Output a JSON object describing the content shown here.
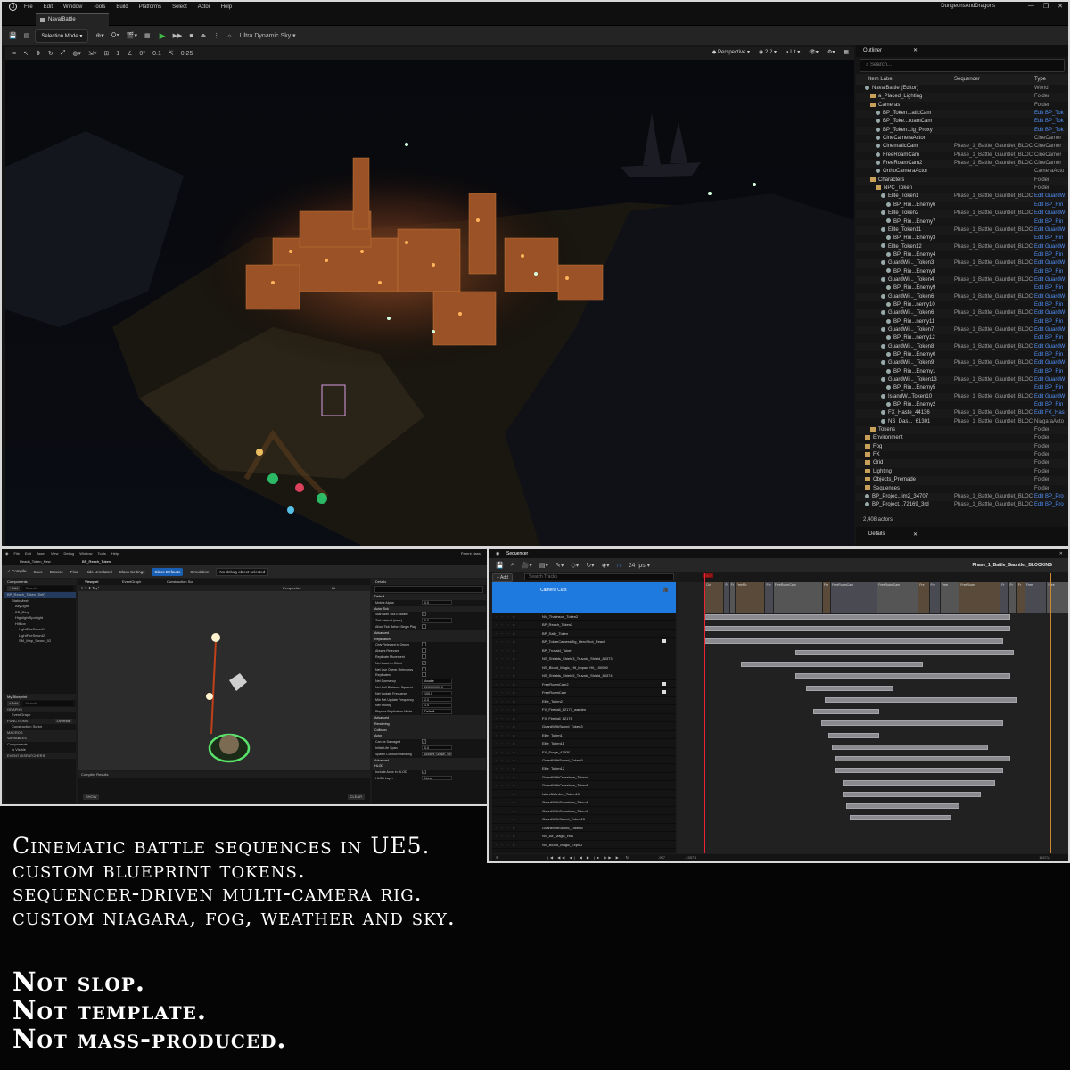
{
  "editor": {
    "menu": [
      "File",
      "Edit",
      "Window",
      "Tools",
      "Build",
      "Platforms",
      "Select",
      "Actor",
      "Help"
    ],
    "project_name": "DungeonsAndDragons",
    "level_tab": "NavalBattle",
    "toolbar": {
      "mode": "Selection Mode",
      "sky": "Ultra Dynamic Sky"
    },
    "viewport_toolbar": {
      "angle": "0°",
      "grid": "0.1",
      "scale": "0.25",
      "view": "Perspective",
      "fov": "2.2",
      "lit": "Lit",
      "snap": "1"
    }
  },
  "outliner": {
    "title": "Outliner",
    "search_placeholder": "Search...",
    "columns": {
      "label": "Item Label",
      "sequencer": "Sequencer",
      "type": "Type"
    },
    "rows": [
      {
        "indent": 1,
        "kind": "world",
        "label": "NavalBattle (Editor)",
        "seq": "",
        "type": "World",
        "link": false
      },
      {
        "indent": 2,
        "kind": "folder",
        "label": "a_Placed_Lighting",
        "seq": "",
        "type": "Folder",
        "link": false
      },
      {
        "indent": 2,
        "kind": "folder",
        "label": "Cameras",
        "seq": "",
        "type": "Folder",
        "link": false
      },
      {
        "indent": 3,
        "kind": "actor",
        "label": "BP_Token...aticCam",
        "seq": "",
        "type": "Edit BP_Tok",
        "link": true
      },
      {
        "indent": 3,
        "kind": "actor",
        "label": "BP_Toke...roamCam",
        "seq": "",
        "type": "Edit BP_Tok",
        "link": true
      },
      {
        "indent": 3,
        "kind": "actor",
        "label": "BP_Token...ig_Proxy",
        "seq": "",
        "type": "Edit BP_Tok",
        "link": true
      },
      {
        "indent": 3,
        "kind": "actor",
        "label": "CineCameraActor",
        "seq": "",
        "type": "CineCamer",
        "link": false
      },
      {
        "indent": 3,
        "kind": "actor",
        "label": "CinematicCam",
        "seq": "Phase_1_Battle_Gauntlet_BLOCK",
        "type": "CineCamer",
        "link": false
      },
      {
        "indent": 3,
        "kind": "actor",
        "label": "FreeRoamCam",
        "seq": "Phase_1_Battle_Gauntlet_BLOCK",
        "type": "CineCamer",
        "link": false
      },
      {
        "indent": 3,
        "kind": "actor",
        "label": "FreeRoamCam2",
        "seq": "Phase_1_Battle_Gauntlet_BLOCK",
        "type": "CineCamer",
        "link": false
      },
      {
        "indent": 3,
        "kind": "actor",
        "label": "OrthoCameraActor",
        "seq": "",
        "type": "CameraActo",
        "link": false
      },
      {
        "indent": 2,
        "kind": "folder",
        "label": "Characters",
        "seq": "",
        "type": "Folder",
        "link": false
      },
      {
        "indent": 3,
        "kind": "folder",
        "label": "NPC_Token",
        "seq": "",
        "type": "Folder",
        "link": false
      },
      {
        "indent": 4,
        "kind": "actor",
        "label": "Elite_Token1",
        "seq": "Phase_1_Battle_Gauntlet_BLOCK",
        "type": "Edit GuardW",
        "link": true
      },
      {
        "indent": 5,
        "kind": "actor",
        "label": "BP_Rin...Enemy6",
        "seq": "",
        "type": "Edit BP_Rin",
        "link": true
      },
      {
        "indent": 4,
        "kind": "actor",
        "label": "Elite_Token2",
        "seq": "Phase_1_Battle_Gauntlet_BLOCK",
        "type": "Edit GuardW",
        "link": true
      },
      {
        "indent": 5,
        "kind": "actor",
        "label": "BP_Rin...Enemy7",
        "seq": "",
        "type": "Edit BP_Rin",
        "link": true
      },
      {
        "indent": 4,
        "kind": "actor",
        "label": "Elite_Token11",
        "seq": "Phase_1_Battle_Gauntlet_BLOCK",
        "type": "Edit GuardW",
        "link": true
      },
      {
        "indent": 5,
        "kind": "actor",
        "label": "BP_Rin...Enemy3",
        "seq": "",
        "type": "Edit BP_Rin",
        "link": true
      },
      {
        "indent": 4,
        "kind": "actor",
        "label": "Elite_Token12",
        "seq": "Phase_1_Battle_Gauntlet_BLOCK",
        "type": "Edit GuardW",
        "link": true
      },
      {
        "indent": 5,
        "kind": "actor",
        "label": "BP_Rin...Enemy4",
        "seq": "",
        "type": "Edit BP_Rin",
        "link": true
      },
      {
        "indent": 4,
        "kind": "actor",
        "label": "GuardWi..._Token3",
        "seq": "Phase_1_Battle_Gauntlet_BLOCK",
        "type": "Edit GuardW",
        "link": true
      },
      {
        "indent": 5,
        "kind": "actor",
        "label": "BP_Rin...Enemy8",
        "seq": "",
        "type": "Edit BP_Rin",
        "link": true
      },
      {
        "indent": 4,
        "kind": "actor",
        "label": "GuardWi..._Token4",
        "seq": "Phase_1_Battle_Gauntlet_BLOCK",
        "type": "Edit GuardW",
        "link": true
      },
      {
        "indent": 5,
        "kind": "actor",
        "label": "BP_Rin...Enemy9",
        "seq": "",
        "type": "Edit BP_Rin",
        "link": true
      },
      {
        "indent": 4,
        "kind": "actor",
        "label": "GuardWi..._Token6",
        "seq": "Phase_1_Battle_Gauntlet_BLOCK",
        "type": "Edit GuardW",
        "link": true
      },
      {
        "indent": 5,
        "kind": "actor",
        "label": "BP_Rin...nemy10",
        "seq": "",
        "type": "Edit BP_Rin",
        "link": true
      },
      {
        "indent": 4,
        "kind": "actor",
        "label": "GuardWi..._Token6",
        "seq": "Phase_1_Battle_Gauntlet_BLOCK",
        "type": "Edit GuardW",
        "link": true
      },
      {
        "indent": 5,
        "kind": "actor",
        "label": "BP_Rin...nemy11",
        "seq": "",
        "type": "Edit BP_Rin",
        "link": true
      },
      {
        "indent": 4,
        "kind": "actor",
        "label": "GuardWi..._Token7",
        "seq": "Phase_1_Battle_Gauntlet_BLOCK",
        "type": "Edit GuardW",
        "link": true
      },
      {
        "indent": 5,
        "kind": "actor",
        "label": "BP_Rin...nemy12",
        "seq": "",
        "type": "Edit BP_Rin",
        "link": true
      },
      {
        "indent": 4,
        "kind": "actor",
        "label": "GuardWi..._Token8",
        "seq": "Phase_1_Battle_Gauntlet_BLOCK",
        "type": "Edit GuardW",
        "link": true
      },
      {
        "indent": 5,
        "kind": "actor",
        "label": "BP_Rin...Enemy0",
        "seq": "",
        "type": "Edit BP_Rin",
        "link": true
      },
      {
        "indent": 4,
        "kind": "actor",
        "label": "GuardWi..._Token9",
        "seq": "Phase_1_Battle_Gauntlet_BLOCK",
        "type": "Edit GuardW",
        "link": true
      },
      {
        "indent": 5,
        "kind": "actor",
        "label": "BP_Rin...Enemy1",
        "seq": "",
        "type": "Edit BP_Rin",
        "link": true
      },
      {
        "indent": 4,
        "kind": "actor",
        "label": "GuardWi..._Token13",
        "seq": "Phase_1_Battle_Gauntlet_BLOCK",
        "type": "Edit GuardW",
        "link": true
      },
      {
        "indent": 5,
        "kind": "actor",
        "label": "BP_Rin...Enemy5",
        "seq": "",
        "type": "Edit BP_Rin",
        "link": true
      },
      {
        "indent": 4,
        "kind": "actor",
        "label": "IslandW...Token10",
        "seq": "Phase_1_Battle_Gauntlet_BLOCK",
        "type": "Edit GuardW",
        "link": true
      },
      {
        "indent": 5,
        "kind": "actor",
        "label": "BP_Rin...Enemy2",
        "seq": "",
        "type": "Edit BP_Rin",
        "link": true
      },
      {
        "indent": 4,
        "kind": "actor",
        "label": "FX_Haste_44136",
        "seq": "Phase_1_Battle_Gauntlet_BLOCK",
        "type": "Edit FX_Has",
        "link": true
      },
      {
        "indent": 4,
        "kind": "actor",
        "label": "NS_Das..._61301",
        "seq": "Phase_1_Battle_Gauntlet_BLOCK",
        "type": "NiagaraActo",
        "link": false
      },
      {
        "indent": 2,
        "kind": "folder",
        "label": "Tokens",
        "seq": "",
        "type": "Folder",
        "link": false
      },
      {
        "indent": 1,
        "kind": "folder",
        "label": "Environment",
        "seq": "",
        "type": "Folder",
        "link": false
      },
      {
        "indent": 1,
        "kind": "folder",
        "label": "Fog",
        "seq": "",
        "type": "Folder",
        "link": false
      },
      {
        "indent": 1,
        "kind": "folder",
        "label": "FX",
        "seq": "",
        "type": "Folder",
        "link": false
      },
      {
        "indent": 1,
        "kind": "folder",
        "label": "Grid",
        "seq": "",
        "type": "Folder",
        "link": false
      },
      {
        "indent": 1,
        "kind": "folder",
        "label": "Lighting",
        "seq": "",
        "type": "Folder",
        "link": false
      },
      {
        "indent": 1,
        "kind": "folder",
        "label": "Objects_Premade",
        "seq": "",
        "type": "Folder",
        "link": false
      },
      {
        "indent": 1,
        "kind": "folder",
        "label": "Sequences",
        "seq": "",
        "type": "Folder",
        "link": false
      },
      {
        "indent": 1,
        "kind": "actor",
        "label": "BP_Projec...im2_34707",
        "seq": "Phase_1_Battle_Gauntlet_BLOCK",
        "type": "Edit BP_Pro",
        "link": true
      },
      {
        "indent": 1,
        "kind": "actor",
        "label": "BP_Project...72169_3rd",
        "seq": "Phase_1_Battle_Gauntlet_BLOCK",
        "type": "Edit BP_Pro",
        "link": true
      }
    ],
    "actor_count": "2,408 actors"
  },
  "details_tab": "Details",
  "blueprint": {
    "menu": [
      "File",
      "Edit",
      "Asset",
      "View",
      "Debug",
      "Window",
      "Tools",
      "Help"
    ],
    "tabs": [
      "Reach_Token_New",
      "BP_Reach_Token"
    ],
    "parent_class": "Parent class:",
    "toolbar": [
      "Compile",
      "Save",
      "Browse",
      "Find",
      "Hide Unrelated",
      "Class Settings",
      "Class Defaults",
      "Simulation"
    ],
    "debug_filter": "No debug object selected",
    "components_title": "Components",
    "add_label": "+ Add",
    "search_placeholder": "Search",
    "components": [
      "BP_Reach_Token (Self)",
      "StaticMesh",
      "AllyLight",
      "BP_Ring",
      "HighlightSpotlight",
      "HitBox",
      "LightFireSword1",
      "LightFireSword2",
      "SM_Map_Sword_02"
    ],
    "my_blueprint": "My Blueprint",
    "sections": [
      "GRAPHS",
      "EventGraph",
      "FUNCTIONS",
      "Construction Script",
      "MACROS",
      "VARIABLES",
      "Components",
      "Is Visible",
      "EVENT DISPATCHERS"
    ],
    "override": "Override",
    "viewport_tabs": [
      "Viewport",
      "EventGraph",
      "Construction Scr"
    ],
    "vp_mode": "Perspective",
    "vp_lit": "Lit",
    "compiler_results": "Compiler Results",
    "show_label": "SHOW",
    "clear_label": "CLEAR",
    "details_title": "Details",
    "details": [
      {
        "h": "Default"
      },
      {
        "k": "Mobile Alpha",
        "v": "0.0"
      },
      {
        "h": "Actor Tick"
      },
      {
        "k": "Start with Tick Enabled",
        "c": true
      },
      {
        "k": "Tick Interval (secs)",
        "v": "0.0"
      },
      {
        "k": "Allow Tick Before Begin Play",
        "c": false
      },
      {
        "h": "Advanced"
      },
      {
        "h": "Replication"
      },
      {
        "k": "Only Relevant to Owner",
        "c": false
      },
      {
        "k": "Always Relevant",
        "c": false
      },
      {
        "k": "Replicate Movement",
        "c": false
      },
      {
        "k": "Net Load on Client",
        "c": true
      },
      {
        "k": "Net Use Owner Relevancy",
        "c": false
      },
      {
        "k": "Replicates",
        "c": false
      },
      {
        "k": "Net Dormancy",
        "v": "Awake"
      },
      {
        "k": "Net Cull Distance Squared",
        "v": "225000000.0"
      },
      {
        "k": "Net Update Frequency",
        "v": "100.0"
      },
      {
        "k": "Min Net Update Frequency",
        "v": "2.0"
      },
      {
        "k": "Net Priority",
        "v": "1.0"
      },
      {
        "k": "Physics Replication Mode",
        "v": "Default"
      },
      {
        "h": "Advanced"
      },
      {
        "h": "Rendering"
      },
      {
        "h": "Collision"
      },
      {
        "h": "Actor"
      },
      {
        "k": "Can be Damaged",
        "c": true
      },
      {
        "k": "Initial Life Span",
        "v": "0.0"
      },
      {
        "k": "Spawn Collision Handling",
        "v": "Always Spawn, Ignore Collisions"
      },
      {
        "h": "Advanced"
      },
      {
        "h": "HLOD"
      },
      {
        "k": "Include Actor in HLOD",
        "c": true
      },
      {
        "k": "HLOD Layer",
        "v": "None"
      }
    ]
  },
  "sequencer": {
    "title": "Sequencer",
    "fps": "24 fps",
    "sequence_name": "Phase_1_Battle_Gauntlet_BLOCKING",
    "add_label": "+ Add",
    "search_placeholder": "Search Tracks",
    "camera_cuts": "Camera Cuts",
    "playhead_frame": "-907",
    "end_frame": "-907",
    "range_start": "-15571",
    "range_end": "115711",
    "tracks": [
      {
        "name": "NV_Thalinson_Token2",
        "cam": false
      },
      {
        "name": "BP_Reach_Token2",
        "cam": false
      },
      {
        "name": "BP_Sally_Token",
        "cam": false
      },
      {
        "name": "BP_TokenCameraRig_HeroShot_Reach",
        "cam": true
      },
      {
        "name": "BP_Truvald_Token",
        "cam": false
      },
      {
        "name": "NS_Shields_Shield3_Truvald_Shield_88373",
        "cam": false
      },
      {
        "name": "NS_Blood_Magic_Hit_Impact Hit_100000",
        "cam": false
      },
      {
        "name": "NS_Shields_Shield5_Truvald_Shield_88374",
        "cam": false
      },
      {
        "name": "FreeRoamCam2",
        "cam": true
      },
      {
        "name": "FreeRoamCam",
        "cam": true
      },
      {
        "name": "Elite_Token2",
        "cam": false
      },
      {
        "name": "FX_Fireball_82177_warden",
        "cam": false
      },
      {
        "name": "FX_Fireball_82176",
        "cam": false
      },
      {
        "name": "GuardWithSword_Token3",
        "cam": false
      },
      {
        "name": "Elite_Token1",
        "cam": false
      },
      {
        "name": "Elite_Token11",
        "cam": false
      },
      {
        "name": "FX_Surge_47930",
        "cam": false
      },
      {
        "name": "GuardWithSword_Token9",
        "cam": false
      },
      {
        "name": "Elite_Token12",
        "cam": false
      },
      {
        "name": "GuardWithCrossbow_Token4",
        "cam": false
      },
      {
        "name": "GuardWithCrossbow_Token5",
        "cam": false
      },
      {
        "name": "IslandWarden_Token10",
        "cam": false
      },
      {
        "name": "GuardWithCrossbow_Token6",
        "cam": false
      },
      {
        "name": "GuardWithCrossbow_Token7",
        "cam": false
      },
      {
        "name": "GuardWithSword_Token13",
        "cam": false
      },
      {
        "name": "GuardWithSword_Token8",
        "cam": false
      },
      {
        "name": "NS_Air_Magic_Hit4",
        "cam": false
      },
      {
        "name": "NS_Blood_Magic_Explo2",
        "cam": false
      }
    ],
    "cuts": [
      "Cin",
      "Fr",
      "Fr",
      "FreeRo",
      "Fre",
      "FreeRoamCam",
      "Fre",
      "FreeRoamCam",
      "FreeRoamCam",
      "Fre",
      "Fre",
      "Free",
      "FreeRoam",
      "Fr",
      "Fr",
      "Fr",
      "Free",
      "Free"
    ],
    "bars": [
      {
        "start": 0.0,
        "end": 0.84
      },
      {
        "start": 0.0,
        "end": 0.84
      },
      {
        "start": 0.0,
        "end": 0.82
      },
      {
        "start": 0.25,
        "end": 0.85
      },
      {
        "start": 0.1,
        "end": 0.6
      },
      {
        "start": 0.25,
        "end": 0.84
      },
      {
        "start": 0.28,
        "end": 0.52
      },
      {
        "start": 0.33,
        "end": 0.86
      },
      {
        "start": 0.3,
        "end": 0.48
      },
      {
        "start": 0.32,
        "end": 0.82
      },
      {
        "start": 0.34,
        "end": 0.48
      },
      {
        "start": 0.35,
        "end": 0.78
      },
      {
        "start": 0.36,
        "end": 0.84
      },
      {
        "start": 0.36,
        "end": 0.82
      },
      {
        "start": 0.38,
        "end": 0.8
      },
      {
        "start": 0.38,
        "end": 0.76
      },
      {
        "start": 0.39,
        "end": 0.7
      },
      {
        "start": 0.4,
        "end": 0.68
      }
    ]
  },
  "captions": {
    "features": [
      "Cinematic battle sequences in UE5.",
      "custom blueprint tokens.",
      "sequencer-driven multi-camera rig.",
      "custom niagara, fog, weather and sky."
    ],
    "tagline": [
      "Not slop.",
      "Not template.",
      "Not mass-produced."
    ]
  },
  "colors": {
    "accent_blue": "#1f7ae0",
    "link_blue": "#4f8ff7",
    "play_green": "#3fbe4a",
    "playhead_red": "#ee2233",
    "folder": "#c8a05a"
  }
}
